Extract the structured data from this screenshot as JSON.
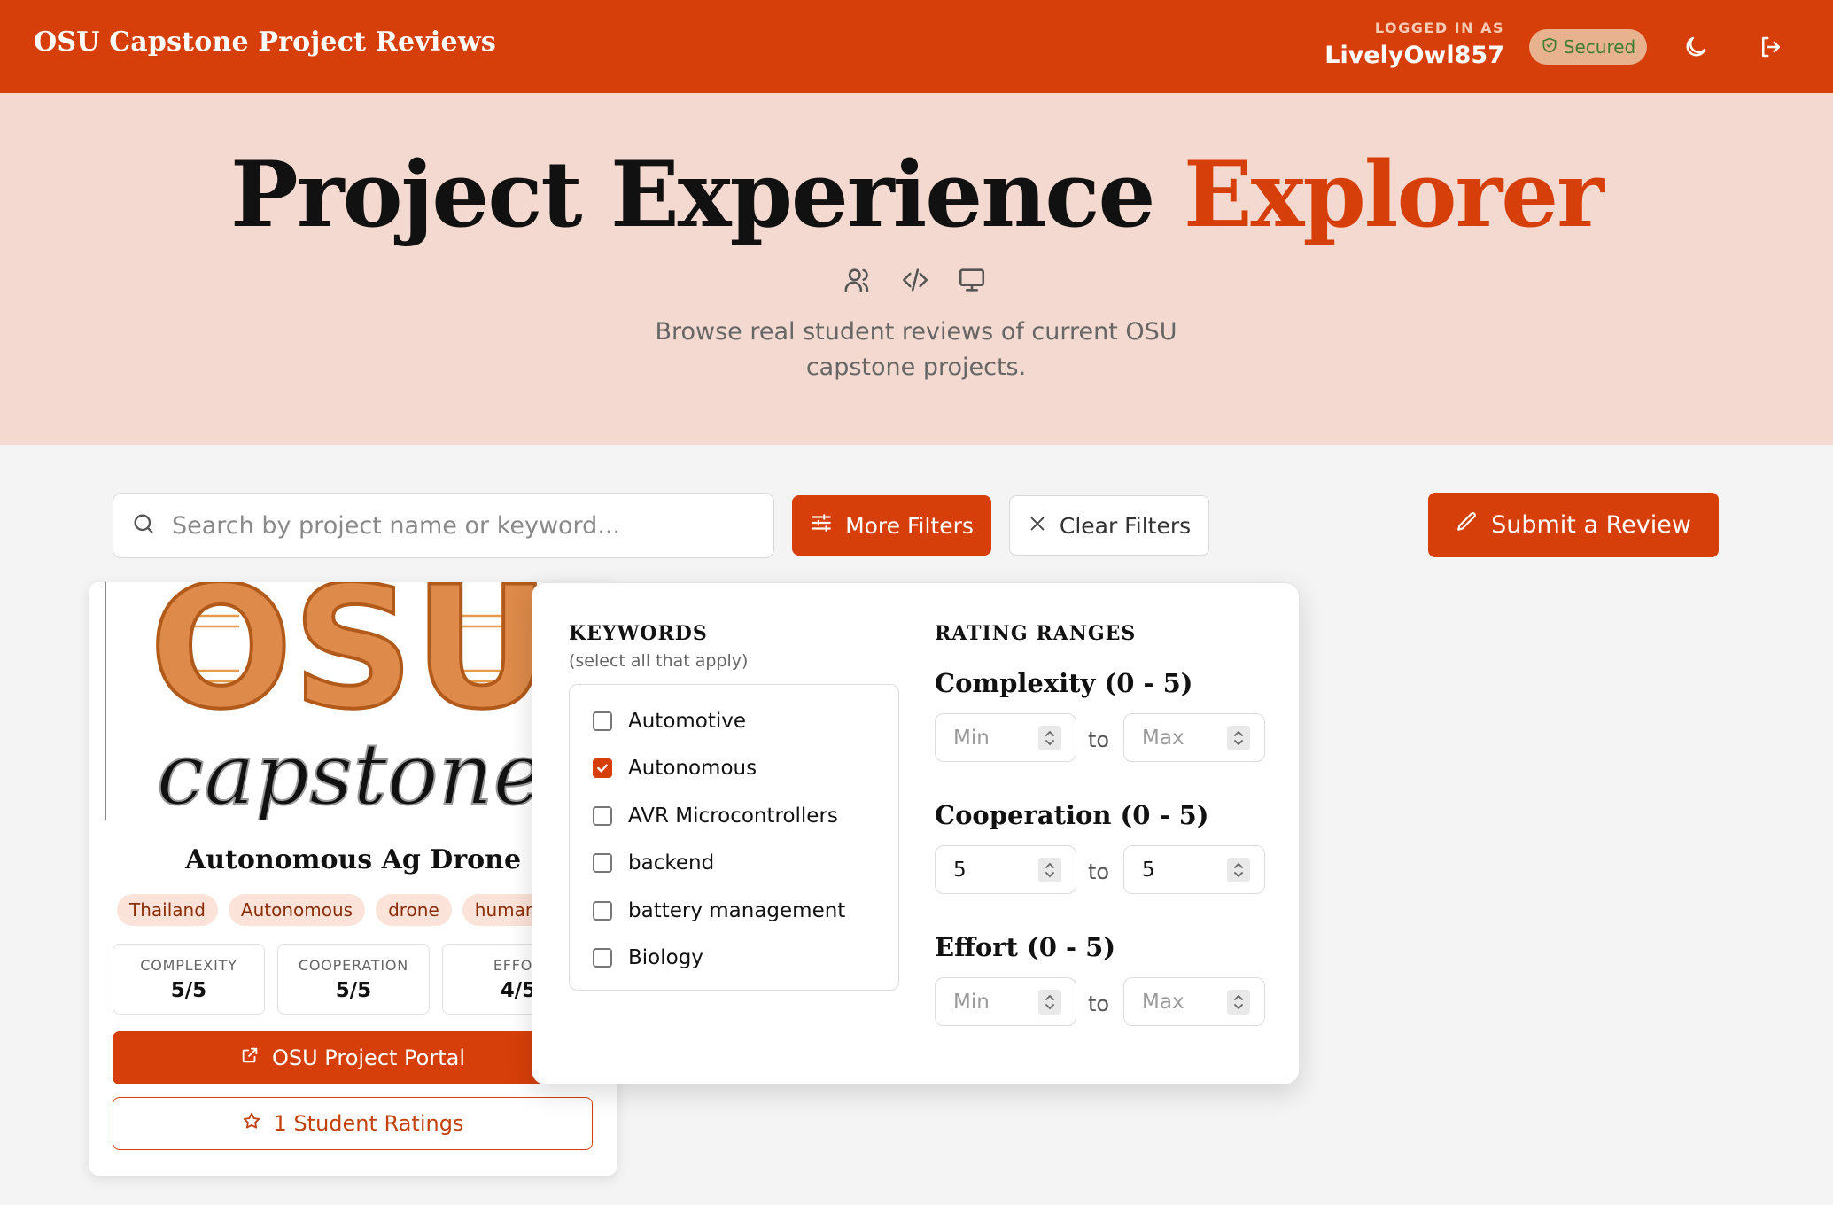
{
  "header": {
    "brand": "OSU Capstone Project Reviews",
    "logged_in_label": "LOGGED IN AS",
    "username": "LivelyOwl857",
    "secured_label": "Secured",
    "icons": [
      "moon-icon",
      "logout-icon",
      "shield-check-icon"
    ]
  },
  "hero": {
    "title_main": "Project Experience",
    "title_accent": "Explorer",
    "subtitle": "Browse real student reviews of current OSU capstone projects.",
    "icons": [
      "users-icon",
      "code-icon",
      "monitor-icon"
    ]
  },
  "toolbar": {
    "search_placeholder": "Search by project name or keyword...",
    "more_filters": "More Filters",
    "clear_filters": "Clear Filters",
    "submit_review": "Submit a Review"
  },
  "card": {
    "image_text_top": "OSU",
    "image_text_bottom": "capstone",
    "title": "Autonomous Ag Drone",
    "tags": [
      "Thailand",
      "Autonomous",
      "drone",
      "humanit"
    ],
    "stats": [
      {
        "label": "COMPLEXITY",
        "value": "5/5"
      },
      {
        "label": "COOPERATION",
        "value": "5/5"
      },
      {
        "label": "EFFOR",
        "value": "4/5"
      }
    ],
    "portal_button": "OSU Project Portal",
    "ratings_button": "1 Student Ratings"
  },
  "filters": {
    "keywords_title": "KEYWORDS",
    "keywords_sub": "(select all that apply)",
    "keywords": [
      {
        "label": "Automotive",
        "checked": false
      },
      {
        "label": "Autonomous",
        "checked": true
      },
      {
        "label": "AVR Microcontrollers",
        "checked": false
      },
      {
        "label": "backend",
        "checked": false
      },
      {
        "label": "battery management",
        "checked": false
      },
      {
        "label": "Biology",
        "checked": false
      }
    ],
    "ranges_title": "RATING RANGES",
    "to_label": "to",
    "ranges": [
      {
        "label": "Complexity (0 - 5)",
        "min": "",
        "max": "",
        "min_placeholder": "Min",
        "max_placeholder": "Max"
      },
      {
        "label": "Cooperation (0 - 5)",
        "min": "5",
        "max": "5",
        "min_placeholder": "Min",
        "max_placeholder": "Max"
      },
      {
        "label": "Effort (0 - 5)",
        "min": "",
        "max": "",
        "min_placeholder": "Min",
        "max_placeholder": "Max"
      }
    ]
  },
  "colors": {
    "accent": "#d63f0a",
    "hero_bg": "#f3d9cf",
    "page_bg": "#f4f4f4",
    "secured_text": "#3f7d2e"
  }
}
